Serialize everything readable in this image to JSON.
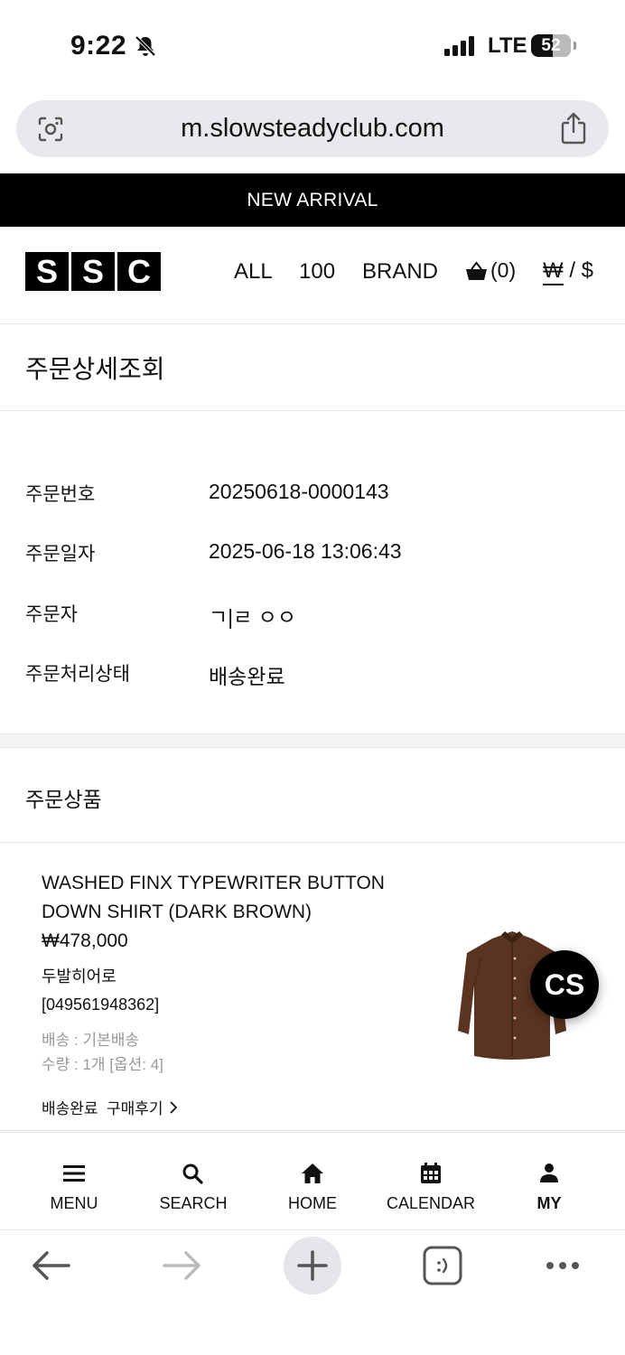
{
  "status_bar": {
    "time": "9:22",
    "network": "LTE",
    "battery": "52"
  },
  "browser": {
    "url": "m.slowsteadyclub.com"
  },
  "banner": {
    "text": "NEW ARRIVAL"
  },
  "header": {
    "logo_letters": [
      "S",
      "S",
      "C"
    ],
    "nav": {
      "all": "ALL",
      "hundred": "100",
      "brand": "BRAND"
    },
    "cart_count": "(0)",
    "currency_won": "₩",
    "currency_sep": " / ",
    "currency_usd": "$"
  },
  "page": {
    "title": "주문상세조회"
  },
  "order_info": {
    "number_label": "주문번호",
    "number_value": "20250618-0000143",
    "date_label": "주문일자",
    "date_value": "2025-06-18 13:06:43",
    "orderer_label": "주문자",
    "orderer_value": "ㄱ|ㄹ ㅇㅇ",
    "status_label": "주문처리상태",
    "status_value": "배송완료"
  },
  "products_section": {
    "title": "주문상품"
  },
  "product": {
    "name": "WASHED FINX TYPEWRITER BUTTON DOWN SHIRT (DARK BROWN)",
    "price": "₩478,000",
    "brand": "두발히어로",
    "code": "[049561948362]",
    "shipping": "배송 : 기본배송",
    "quantity": "수량 : 1개 [옵션: 4]",
    "status": "배송완료",
    "review": "구매후기",
    "image_color": "#5a3420"
  },
  "cs_button": {
    "label": "CS"
  },
  "bottom_nav": {
    "menu": "MENU",
    "search": "SEARCH",
    "home": "HOME",
    "calendar": "CALENDAR",
    "my": "MY"
  }
}
